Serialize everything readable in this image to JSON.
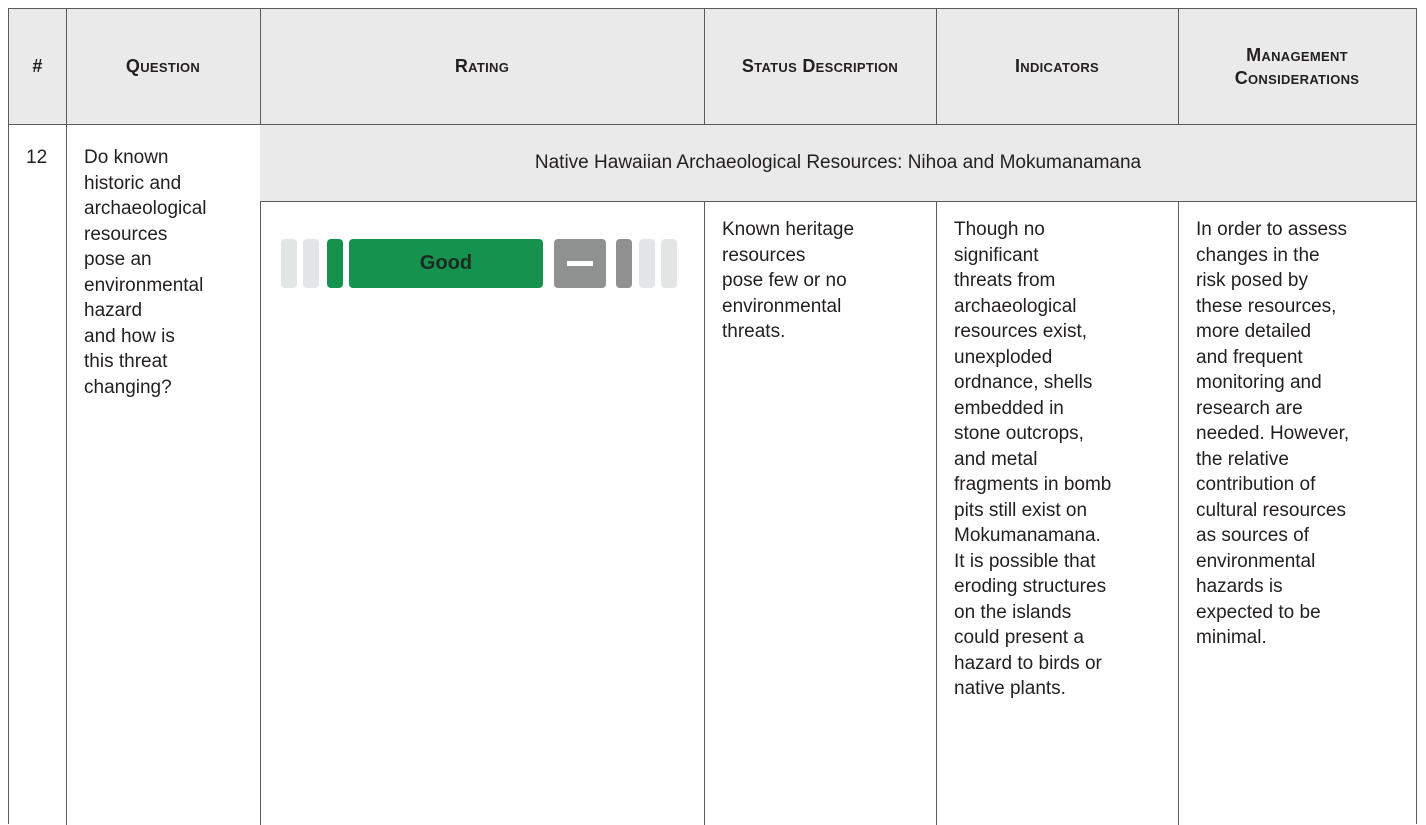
{
  "header": {
    "num": "#",
    "question": "Question",
    "rating": "Rating",
    "status_description": "Status Description",
    "indicators": "Indicators",
    "management_considerations_line1": "Management",
    "management_considerations_line2": "Considerations"
  },
  "row": {
    "number": "12",
    "question": "Do known\nhistoric and\narchaeological\nresources\npose an\nenvironmental\nhazard\nand how is\nthis threat\nchanging?",
    "resource_title": "Native Hawaiian Archaeological Resources: Nihoa and Mokumanamana",
    "rating_label": "Good",
    "rating_trend": "no change",
    "rating_colors": {
      "good": "#16924f",
      "neutral": "#8f9090",
      "inactive": "#e2e6e6"
    },
    "status_description": "Known heritage\nresources\npose few or no\nenvironmental\nthreats.",
    "indicators": "Though no\nsignificant\nthreats from\narchaeological\nresources exist,\nunexploded\nordnance, shells\nembedded in\nstone outcrops,\nand metal\nfragments in bomb\npits still exist on\nMokumanamana.\nIt is possible that\neroding structures\non the islands\ncould present a\nhazard to birds or\nnative plants.",
    "management_considerations": "In order to assess\nchanges in the\nrisk posed by\nthese resources,\nmore detailed\nand frequent\nmonitoring and\nresearch are\nneeded. However,\nthe relative\ncontribution of\ncultural resources\nas sources of\nenvironmental\nhazards is\nexpected to be\nminimal."
  }
}
